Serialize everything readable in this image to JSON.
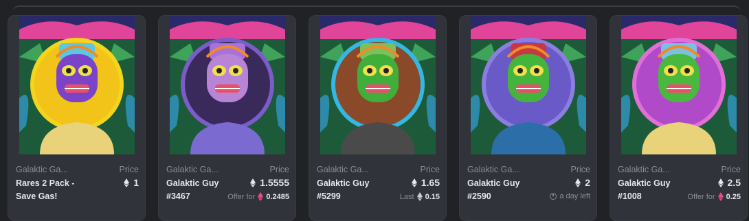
{
  "cards": [
    {
      "collection": "Galaktic Ga...",
      "price_label": "Price",
      "name_line1": "Rares 2 Pack -",
      "name_line2": "Save Gas!",
      "price": "1",
      "sub_prefix": "",
      "sub_value": "",
      "art_bg": "#f2c318",
      "art_ring": "#f2d51c",
      "skin": "#7b43c7"
    },
    {
      "collection": "Galaktic Ga...",
      "price_label": "Price",
      "name_line1": "Galaktic Guy",
      "name_line2": "#3467",
      "price": "1.5555",
      "sub_prefix": "Offer for",
      "sub_value": "0.2485",
      "art_bg": "#3a2a5c",
      "art_ring": "#7b5cc9",
      "skin": "#b784d6"
    },
    {
      "collection": "Galaktic Ga...",
      "price_label": "Price",
      "name_line1": "Galaktic Guy",
      "name_line2": "#5299",
      "price": "1.65",
      "sub_prefix": "Last",
      "sub_value": "0.15",
      "art_bg": "#8a4a2a",
      "art_ring": "#36b6e3",
      "skin": "#3fae3b"
    },
    {
      "collection": "Galaktic Ga...",
      "price_label": "Price",
      "name_line1": "Galaktic Guy",
      "name_line2": "#2590",
      "price": "2",
      "sub_prefix": "a day left",
      "sub_value": "",
      "art_bg": "#6a5ac8",
      "art_ring": "#8c7ee0",
      "skin": "#45b43d"
    },
    {
      "collection": "Galaktic Ga...",
      "price_label": "Price",
      "name_line1": "Galaktic Guy",
      "name_line2": "#1008",
      "price": "2.5",
      "sub_prefix": "Offer for",
      "sub_value": "0.25",
      "art_bg": "#b04ac8",
      "art_ring": "#e070d8",
      "skin": "#4ab83e"
    }
  ],
  "colors": {
    "card_bg": "#303339",
    "text_primary": "#e5e8eb",
    "text_secondary": "#8a8d92",
    "weth": "#e84a8a"
  },
  "icons": {
    "price_currency": "eth-icon",
    "offer_currency": "weth-icon",
    "timer": "clock-icon"
  }
}
